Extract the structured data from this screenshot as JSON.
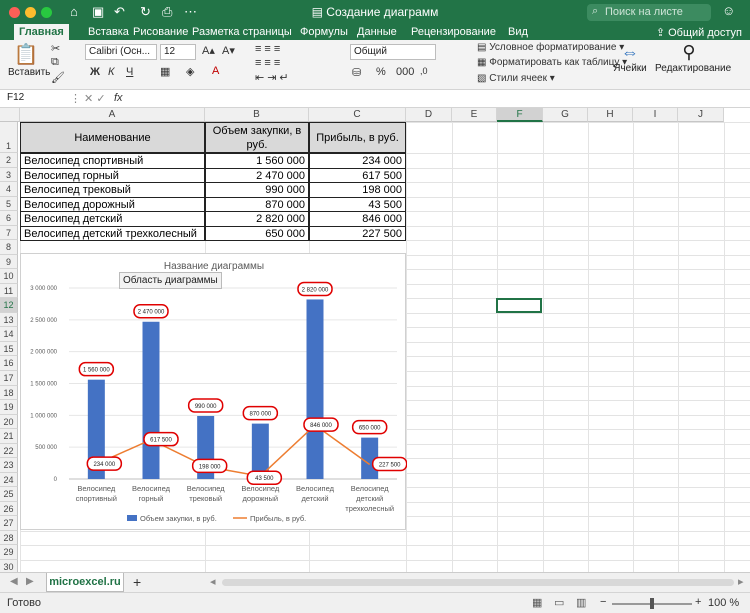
{
  "window": {
    "title": "Создание диаграмм",
    "search_placeholder": "Поиск на листе"
  },
  "tabs": [
    "Главная",
    "Вставка",
    "Рисование",
    "Разметка страницы",
    "Формулы",
    "Данные",
    "Рецензирование",
    "Вид"
  ],
  "share_label": "Общий доступ",
  "ribbon": {
    "paste_label": "Вставить",
    "font_name": "Calibri (Осн...",
    "font_size": "12",
    "number_format": "Общий",
    "conditional_format": "Условное форматирование",
    "format_as_table": "Форматировать как таблицу",
    "cell_styles": "Стили ячеек",
    "cells_label": "Ячейки",
    "editing_label": "Редактирование",
    "bold": "Ж",
    "italic": "К",
    "underline": "Ч"
  },
  "formula_bar": {
    "name_box": "F12",
    "fx": "fx",
    "value": ""
  },
  "columns": [
    "A",
    "B",
    "C",
    "D",
    "E",
    "F",
    "G",
    "H",
    "I",
    "J"
  ],
  "rows": [
    "1",
    "2",
    "3",
    "4",
    "5",
    "6",
    "7",
    "8",
    "9",
    "10",
    "11",
    "12",
    "13",
    "14",
    "15",
    "16",
    "17",
    "18",
    "19",
    "20",
    "21",
    "22",
    "23",
    "24",
    "25",
    "26",
    "27",
    "28",
    "29",
    "30",
    "31"
  ],
  "table": {
    "headers": [
      "Наименование",
      "Объем закупки, в руб.",
      "Прибыль, в руб."
    ],
    "rows": [
      [
        "Велосипед спортивный",
        "1 560 000",
        "234 000"
      ],
      [
        "Велосипед горный",
        "2 470 000",
        "617 500"
      ],
      [
        "Велосипед трековый",
        "990 000",
        "198 000"
      ],
      [
        "Велосипед дорожный",
        "870 000",
        "43 500"
      ],
      [
        "Велосипед детский",
        "2 820 000",
        "846 000"
      ],
      [
        "Велосипед детский трехколесный",
        "650 000",
        "227 500"
      ]
    ]
  },
  "chart_data": {
    "type": "bar",
    "title": "Название диаграммы",
    "tooltip": "Область диаграммы",
    "categories": [
      "Велосипед спортивный",
      "Велосипед горный",
      "Велосипед трековый",
      "Велосипед дорожный",
      "Велосипед детский",
      "Велосипед детский трехколесный"
    ],
    "category_lines": [
      [
        "Велосипед",
        "спортивный"
      ],
      [
        "Велосипед",
        "горный"
      ],
      [
        "Велосипед",
        "трековый"
      ],
      [
        "Велосипед",
        "дорожный"
      ],
      [
        "Велосипед",
        "детский"
      ],
      [
        "Велосипед",
        "детский",
        "трехколесный"
      ]
    ],
    "series": [
      {
        "name": "Объем закупки, в руб.",
        "type": "bar",
        "color": "#4472c4",
        "values": [
          1560000,
          2470000,
          990000,
          870000,
          2820000,
          650000
        ],
        "labels": [
          "1 560 000",
          "2 470 000",
          "990 000",
          "870 000",
          "2 820 000",
          "650 000"
        ]
      },
      {
        "name": "Прибыль, в руб.",
        "type": "line",
        "color": "#ed7d31",
        "values": [
          234000,
          617500,
          198000,
          43500,
          846000,
          227500
        ],
        "labels": [
          "234 000",
          "617 500",
          "198 000",
          "43 500",
          "846 000",
          "227 500"
        ]
      }
    ],
    "yticks": [
      "0",
      "500 000",
      "1 000 000",
      "1 500 000",
      "2 000 000",
      "2 500 000",
      "3 000 000"
    ],
    "ylim": [
      0,
      3000000
    ],
    "legend": "bottom",
    "label_highlight": "#e00000"
  },
  "sheet": {
    "tab": "microexcel.ru",
    "add": "+"
  },
  "status": {
    "ready": "Готово",
    "zoom": "100 %"
  }
}
